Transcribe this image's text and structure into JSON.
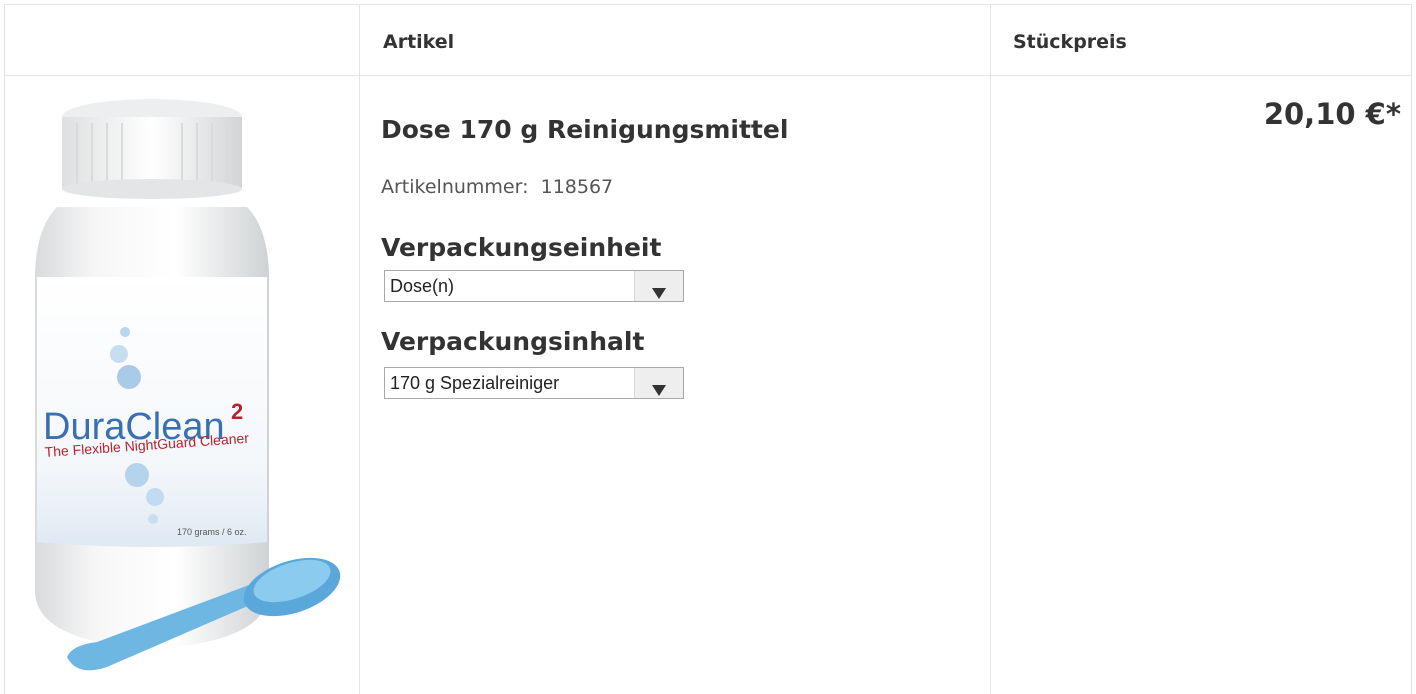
{
  "table": {
    "headers": {
      "artikel": "Artikel",
      "stueckpreis": "Stückpreis"
    }
  },
  "product": {
    "title": "Dose 170 g Reinigungsmittel",
    "article_number_label": "Artikelnummer:",
    "article_number": "118567",
    "image": {
      "brand": "DuraClean",
      "brand_superscript": "2",
      "tagline": "The Flexible NightGuard Cleaner",
      "size": "170 grams / 6 oz."
    },
    "packaging_unit": {
      "label": "Verpackungseinheit",
      "selected": "Dose(n)"
    },
    "packaging_content": {
      "label": "Verpackungsinhalt",
      "selected": "170 g Spezialreiniger"
    },
    "price": "20,10 €*"
  },
  "colors": {
    "border": "#e4e4e4",
    "text": "#333333",
    "brand_blue": "#3a6fb0",
    "brand_red": "#b8232f",
    "scoop": "#6fb7e3"
  }
}
